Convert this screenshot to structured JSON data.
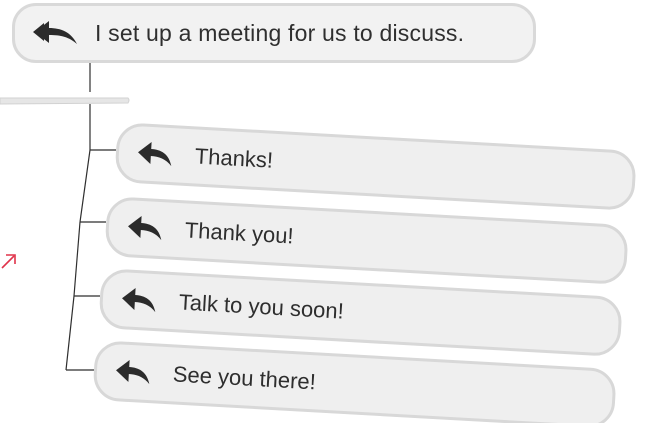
{
  "original_message": {
    "text": "I set up a meeting for us to discuss.",
    "icon": "reply-all-icon"
  },
  "replies": [
    {
      "label": "Thanks!",
      "icon": "reply-icon"
    },
    {
      "label": "Thank you!",
      "icon": "reply-icon"
    },
    {
      "label": "Talk to you soon!",
      "icon": "reply-icon"
    },
    {
      "label": "See you there!",
      "icon": "reply-icon"
    }
  ],
  "colors": {
    "bubble_fill": "#f2f2f2",
    "bubble_border": "#d9d9d9",
    "icon": "#2b2b2b",
    "text": "#2f2f2f",
    "accent_arrow": "#e0334a"
  }
}
